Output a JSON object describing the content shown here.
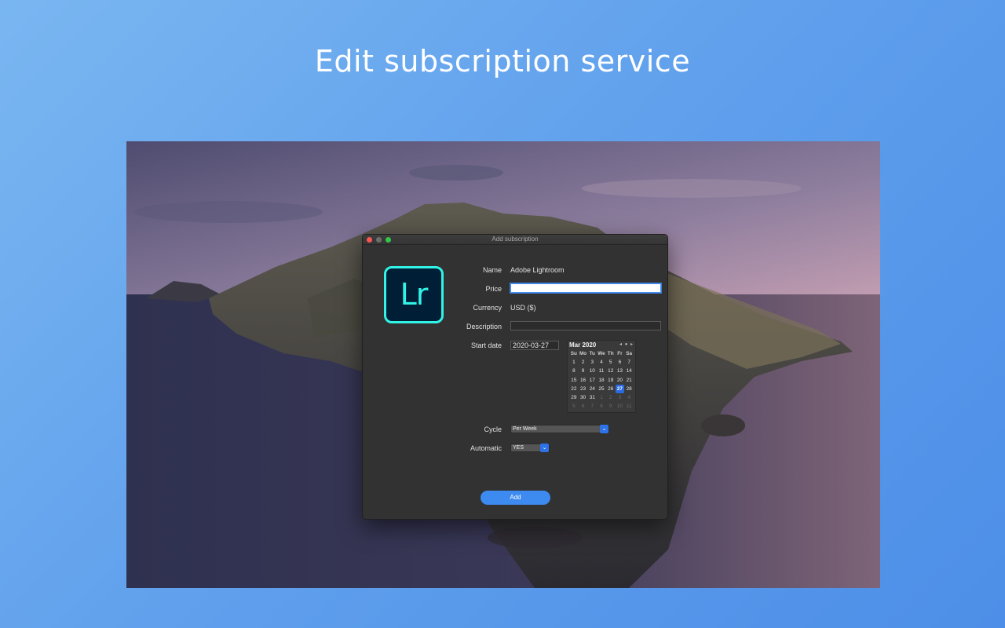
{
  "page": {
    "headline": "Edit subscription service",
    "background_colors": [
      "#79b6f1",
      "#4d8ee8"
    ]
  },
  "window": {
    "title": "Add subscription",
    "app_icon": {
      "name": "adobe-lightroom-icon",
      "text": "Lr",
      "bg": "#001e36",
      "accent": "#31f4e6"
    },
    "form": {
      "name_label": "Name",
      "name_value": "Adobe Lightroom",
      "price_label": "Price",
      "price_value": "",
      "currency_label": "Currency",
      "currency_value": "USD ($)",
      "description_label": "Description",
      "description_value": "",
      "start_date_label": "Start date",
      "start_date_value": "2020-03-27",
      "cycle_label": "Cycle",
      "cycle_value": "Per Week",
      "automatic_label": "Automatic",
      "automatic_value": "YES"
    },
    "calendar": {
      "month": "Mar 2020",
      "nav": "◂ ● ▸",
      "weekdays": [
        "Su",
        "Mo",
        "Tu",
        "We",
        "Th",
        "Fr",
        "Sa"
      ],
      "days": [
        {
          "d": "1",
          "m": "cur"
        },
        {
          "d": "2",
          "m": "cur"
        },
        {
          "d": "3",
          "m": "cur"
        },
        {
          "d": "4",
          "m": "cur"
        },
        {
          "d": "5",
          "m": "cur"
        },
        {
          "d": "6",
          "m": "cur"
        },
        {
          "d": "7",
          "m": "cur"
        },
        {
          "d": "8",
          "m": "cur"
        },
        {
          "d": "9",
          "m": "cur"
        },
        {
          "d": "10",
          "m": "cur"
        },
        {
          "d": "11",
          "m": "cur"
        },
        {
          "d": "12",
          "m": "cur"
        },
        {
          "d": "13",
          "m": "cur"
        },
        {
          "d": "14",
          "m": "cur"
        },
        {
          "d": "15",
          "m": "cur"
        },
        {
          "d": "16",
          "m": "cur"
        },
        {
          "d": "17",
          "m": "cur"
        },
        {
          "d": "18",
          "m": "cur"
        },
        {
          "d": "19",
          "m": "cur"
        },
        {
          "d": "20",
          "m": "cur"
        },
        {
          "d": "21",
          "m": "cur"
        },
        {
          "d": "22",
          "m": "cur"
        },
        {
          "d": "23",
          "m": "cur"
        },
        {
          "d": "24",
          "m": "cur"
        },
        {
          "d": "25",
          "m": "cur"
        },
        {
          "d": "26",
          "m": "cur"
        },
        {
          "d": "27",
          "m": "sel"
        },
        {
          "d": "28",
          "m": "cur"
        },
        {
          "d": "29",
          "m": "cur"
        },
        {
          "d": "30",
          "m": "cur"
        },
        {
          "d": "31",
          "m": "cur"
        },
        {
          "d": "1",
          "m": "dim"
        },
        {
          "d": "2",
          "m": "dim"
        },
        {
          "d": "3",
          "m": "dim"
        },
        {
          "d": "4",
          "m": "dim"
        },
        {
          "d": "5",
          "m": "dim"
        },
        {
          "d": "6",
          "m": "dim"
        },
        {
          "d": "7",
          "m": "dim"
        },
        {
          "d": "8",
          "m": "dim"
        },
        {
          "d": "9",
          "m": "dim"
        },
        {
          "d": "10",
          "m": "dim"
        },
        {
          "d": "11",
          "m": "dim"
        }
      ],
      "selected_color": "#2b6ae0"
    },
    "add_button": "Add"
  }
}
